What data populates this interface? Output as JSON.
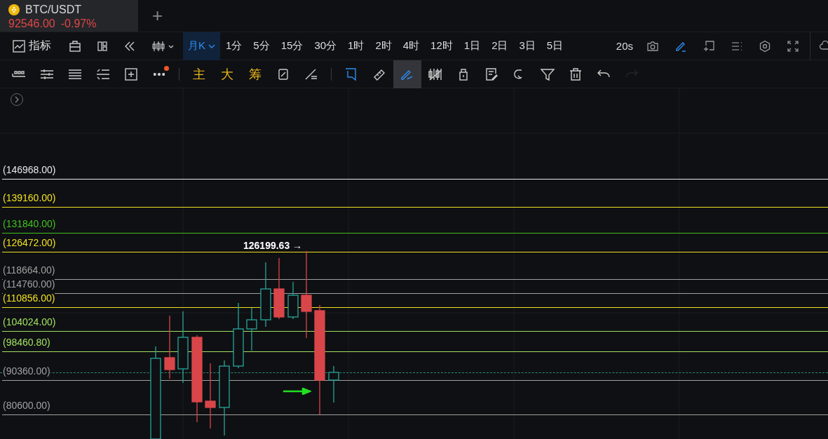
{
  "tabs": [
    {
      "pair": "BTC/USDT",
      "price": "92546.00",
      "change": "-0.97%",
      "selected": true
    }
  ],
  "add_tab": "+",
  "toolbar": {
    "indicators": "指标",
    "intervals": [
      {
        "label": "月K",
        "selected": true,
        "kind": "dropdown"
      },
      {
        "label": "1分",
        "selected": false,
        "kind": "plain"
      },
      {
        "label": "5分",
        "selected": false,
        "kind": "plain"
      },
      {
        "label": "15分",
        "selected": false,
        "kind": "plain"
      },
      {
        "label": "30分",
        "selected": false,
        "kind": "plain"
      },
      {
        "label": "1时",
        "selected": false,
        "kind": "plain"
      },
      {
        "label": "2时",
        "selected": false,
        "kind": "plain"
      },
      {
        "label": "4时",
        "selected": false,
        "kind": "plain"
      },
      {
        "label": "12时",
        "selected": false,
        "kind": "plain"
      },
      {
        "label": "1日",
        "selected": false,
        "kind": "plain"
      },
      {
        "label": "2日",
        "selected": false,
        "kind": "plain"
      },
      {
        "label": "3日",
        "selected": false,
        "kind": "plain"
      },
      {
        "label": "5日",
        "selected": false,
        "kind": "plain"
      }
    ],
    "refresh": "20s",
    "draw_mode_on": true
  },
  "drawing_tools": [
    {
      "kind": "price-line",
      "selected": false,
      "disabled": false
    },
    {
      "kind": "sliders",
      "selected": false,
      "disabled": false
    },
    {
      "kind": "lines",
      "selected": false,
      "disabled": false
    },
    {
      "kind": "list",
      "selected": false,
      "disabled": false
    },
    {
      "kind": "add-box",
      "selected": false,
      "disabled": false
    },
    {
      "kind": "more",
      "selected": false,
      "disabled": false,
      "badge": true
    },
    {
      "kind": "separator"
    },
    {
      "kind": "text",
      "label": "主",
      "selected": false,
      "disabled": false
    },
    {
      "kind": "text",
      "label": "大",
      "selected": false,
      "disabled": false
    },
    {
      "kind": "text",
      "label": "筹",
      "selected": false,
      "disabled": false
    },
    {
      "kind": "swap",
      "selected": false,
      "disabled": false
    },
    {
      "kind": "cross-lines",
      "selected": false,
      "disabled": false
    },
    {
      "kind": "separator"
    },
    {
      "kind": "bookmark",
      "selected": false,
      "disabled": false
    },
    {
      "kind": "ruler",
      "selected": false,
      "disabled": false
    },
    {
      "kind": "pen",
      "selected": true,
      "disabled": false
    },
    {
      "kind": "candles",
      "selected": false,
      "disabled": false
    },
    {
      "kind": "lock",
      "selected": false,
      "disabled": false
    },
    {
      "kind": "note",
      "selected": false,
      "disabled": false
    },
    {
      "kind": "magnet",
      "selected": false,
      "disabled": false
    },
    {
      "kind": "filter",
      "selected": false,
      "disabled": false
    },
    {
      "kind": "trash",
      "selected": false,
      "disabled": false
    },
    {
      "kind": "undo",
      "selected": false,
      "disabled": false
    },
    {
      "kind": "redo",
      "selected": false,
      "disabled": true
    }
  ],
  "price_levels": [
    {
      "label": "(146968.00)",
      "color": "#e8e8e8"
    },
    {
      "label": "(139160.00)",
      "color": "#f0e020"
    },
    {
      "label": "(131840.00)",
      "color": "#40c020"
    },
    {
      "label": "(126472.00)",
      "color": "#f0e020"
    },
    {
      "label": "(118664.00)",
      "color": "#a0a0a0"
    },
    {
      "label": "(114760.00)",
      "color": "#a0a0a0"
    },
    {
      "label": "(110856.00)",
      "color": "#f0e020"
    },
    {
      "label": "(104024.00)",
      "color": "#a0e060"
    },
    {
      "label": "(98460.80)",
      "color": "#a0e060"
    },
    {
      "label": "(90360.00)",
      "color": "#a0a0a0"
    },
    {
      "label": "(80600.00)",
      "color": "#a0a0a0"
    }
  ],
  "high_marker": "126199.63 →"
}
